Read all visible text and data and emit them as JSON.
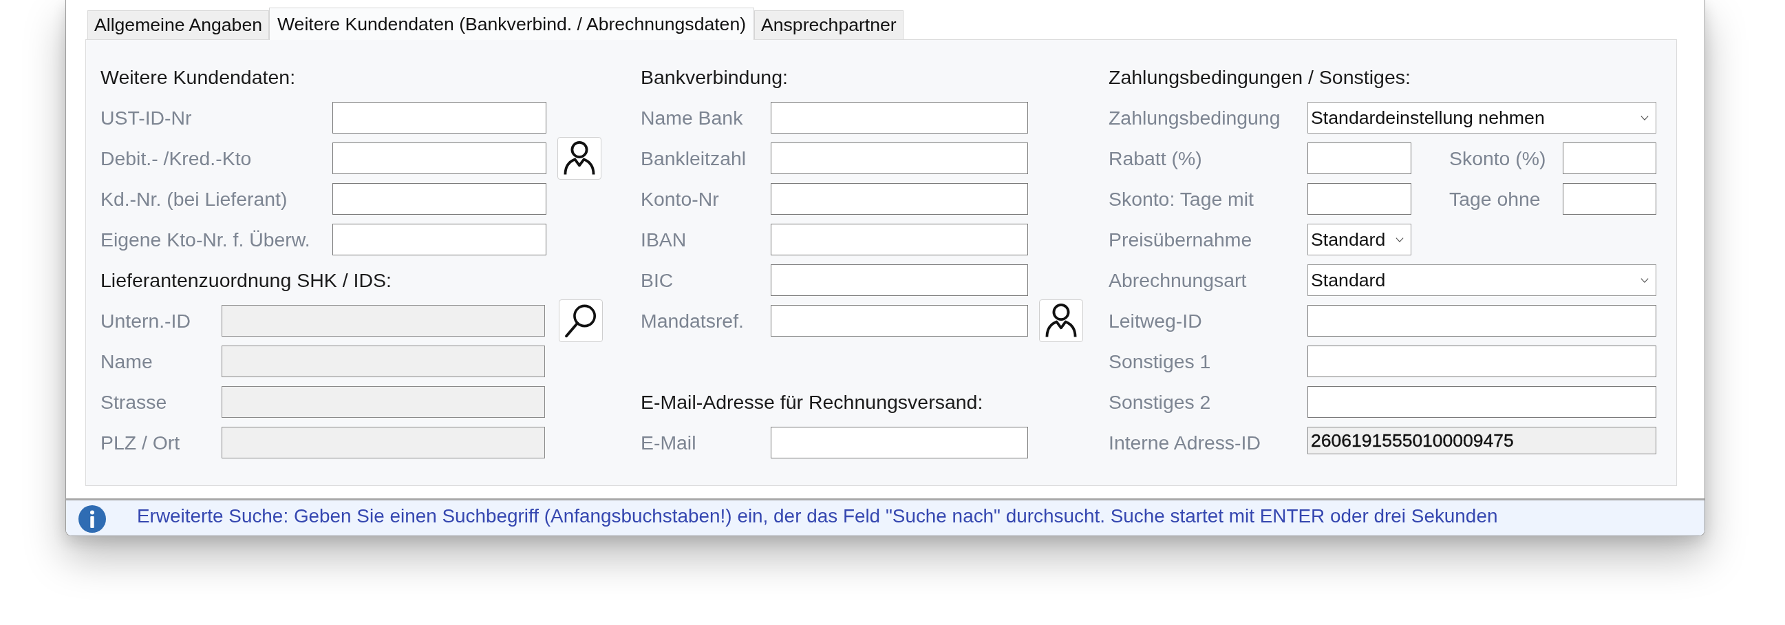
{
  "tabs": [
    {
      "label": "Allgemeine Angaben",
      "selected": false
    },
    {
      "label": "Weitere Kundendaten (Bankverbind. / Abrechnungsdaten)",
      "selected": true
    },
    {
      "label": "Ansprechpartner",
      "selected": false
    }
  ],
  "columns": [
    {
      "sections": [
        {
          "title": "Weitere Kundendaten:",
          "fields": [
            {
              "kind": "text",
              "label": "UST-ID-Nr",
              "disabled": false
            },
            {
              "kind": "text",
              "label": "Debit.- /Kred.-Kto",
              "disabled": false,
              "button": {
                "kind": "lookup"
              }
            },
            {
              "kind": "text",
              "label": "Kd.-Nr. (bei Lieferant)",
              "disabled": false
            },
            {
              "kind": "text",
              "label": "Eigene Kto-Nr. f. Überw.",
              "disabled": false
            }
          ]
        },
        {
          "title": "Lieferantenzuordnung SHK / IDS:",
          "fields": [
            {
              "kind": "text",
              "label": "Untern.-ID",
              "disabled": true,
              "button": {
                "kind": "search"
              }
            },
            {
              "kind": "text",
              "label": "Name",
              "disabled": true
            },
            {
              "kind": "text",
              "label": "Strasse",
              "disabled": true
            },
            {
              "kind": "text",
              "label": "PLZ / Ort",
              "disabled": true
            }
          ]
        }
      ]
    },
    {
      "sections": [
        {
          "title": "Bankverbindung:",
          "fields": [
            {
              "kind": "text",
              "label": "Name Bank",
              "disabled": false
            },
            {
              "kind": "text",
              "label": "Bankleitzahl",
              "disabled": false
            },
            {
              "kind": "text",
              "label": "Konto-Nr",
              "disabled": false
            },
            {
              "kind": "text",
              "label": "IBAN",
              "disabled": false
            },
            {
              "kind": "text",
              "label": "BIC",
              "disabled": false
            },
            {
              "kind": "text",
              "label": "Mandatsref.",
              "disabled": false,
              "button": {
                "kind": "lookup"
              }
            }
          ]
        },
        {
          "title": "E-Mail-Adresse für Rechnungsversand:",
          "fields": [
            {
              "kind": "text",
              "label": "E-Mail",
              "disabled": false
            }
          ]
        }
      ]
    },
    {
      "sections": [
        {
          "title": "Zahlungsbedingungen / Sonstiges:",
          "fields": [
            {
              "kind": "dropdown",
              "label": "Zahlungsbedingung",
              "value": "Standardeinstellung nehmen",
              "disabled": false
            },
            {
              "kind": "pair",
              "label": "Rabatt (%)",
              "disabled": false,
              "second": {
                "label": "Skonto (%)",
                "disabled": false
              }
            },
            {
              "kind": "pair",
              "label": "Skonto: Tage mit",
              "disabled": false,
              "second": {
                "label": "Tage ohne",
                "disabled": false
              }
            },
            {
              "kind": "compact-dropdown",
              "label": "Preisübernahme",
              "value": "Standard",
              "disabled": false
            },
            {
              "kind": "dropdown",
              "label": "Abrechnungsart",
              "value": "Standard",
              "disabled": false
            },
            {
              "kind": "text",
              "label": "Leitweg-ID",
              "disabled": false
            },
            {
              "kind": "text",
              "label": "Sonstiges 1",
              "disabled": false
            },
            {
              "kind": "text",
              "label": "Sonstiges 2",
              "disabled": false
            },
            {
              "kind": "text",
              "label": "Interne Adress-ID",
              "value": "26061915550100009475",
              "disabled": true
            }
          ]
        }
      ]
    }
  ],
  "status_bar": {
    "kind": "info",
    "text": "Erweiterte Suche: Geben Sie einen Suchbegriff (Anfangsbuchstaben!) ein, der das Feld \"Suche nach\" durchsucht. Suche startet mit ENTER oder drei Sekunden"
  }
}
